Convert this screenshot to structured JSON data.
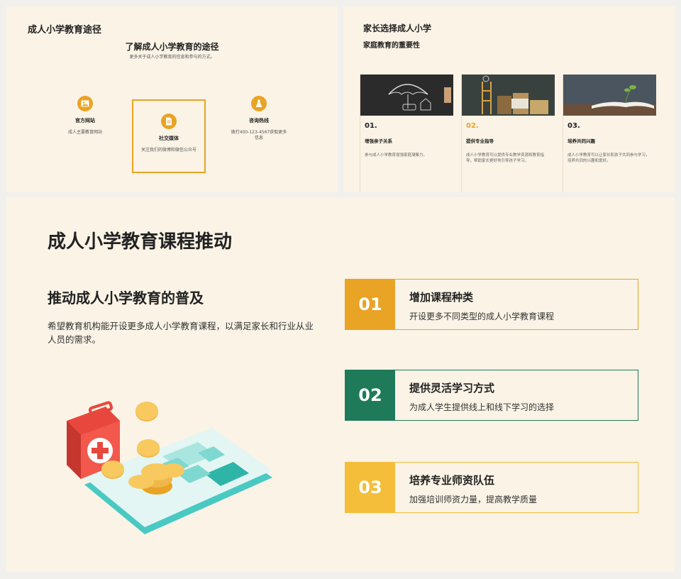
{
  "slide1": {
    "title": "成人小学教育途径",
    "subtitle": "了解成人小学教育的途径",
    "desc": "更多关于成人小学教育的信息和参与的方式。",
    "channels": [
      {
        "icon": "image-icon",
        "label": "官方网站",
        "desc": "成人主要教育网站"
      },
      {
        "icon": "document-icon",
        "label": "社交媒体",
        "desc": "关注我们的微博和微信公众号"
      },
      {
        "icon": "flask-icon",
        "label": "咨询热线",
        "desc": "拨打400-123-4567获取更多信息"
      }
    ]
  },
  "slide2": {
    "title": "家长选择成人小学",
    "subtitle": "家庭教育的重要性",
    "columns": [
      {
        "num": "01.",
        "heading": "增强亲子关系",
        "desc": "参与成人小学教育增强家庭凝聚力。",
        "image": "chalkboard-umbrella-family"
      },
      {
        "num": "02.",
        "heading": "提供专业指导",
        "desc": "成人小学教育可以提供专业教学资源和教育指导，帮助家长更好地引导孩子学习。",
        "image": "books-ladder-chalkboard"
      },
      {
        "num": "03.",
        "heading": "培养共同兴趣",
        "desc": "成人小学教育可以让家长和孩子共同参与学习，培养共同的兴趣和爱好。",
        "image": "open-book-plant"
      }
    ]
  },
  "slide3": {
    "title": "成人小学教育课程推动",
    "subtitle": "推动成人小学教育的普及",
    "desc": "希望教育机构能开设更多成人小学教育课程，以满足家长和行业从业人员的需求。",
    "items": [
      {
        "num": "01",
        "title": "增加课程种类",
        "desc": "开设更多不同类型的成人小学教育课程",
        "color": "#e9a325"
      },
      {
        "num": "02",
        "title": "提供灵活学习方式",
        "desc": "为成人学生提供线上和线下学习的选择",
        "color": "#1f7a5a"
      },
      {
        "num": "03",
        "title": "培养专业师资队伍",
        "desc": "加强培训师资力量，提高教学质量",
        "color": "#f5be3a"
      }
    ],
    "illustration": "calculator-coins-medical-kit"
  }
}
